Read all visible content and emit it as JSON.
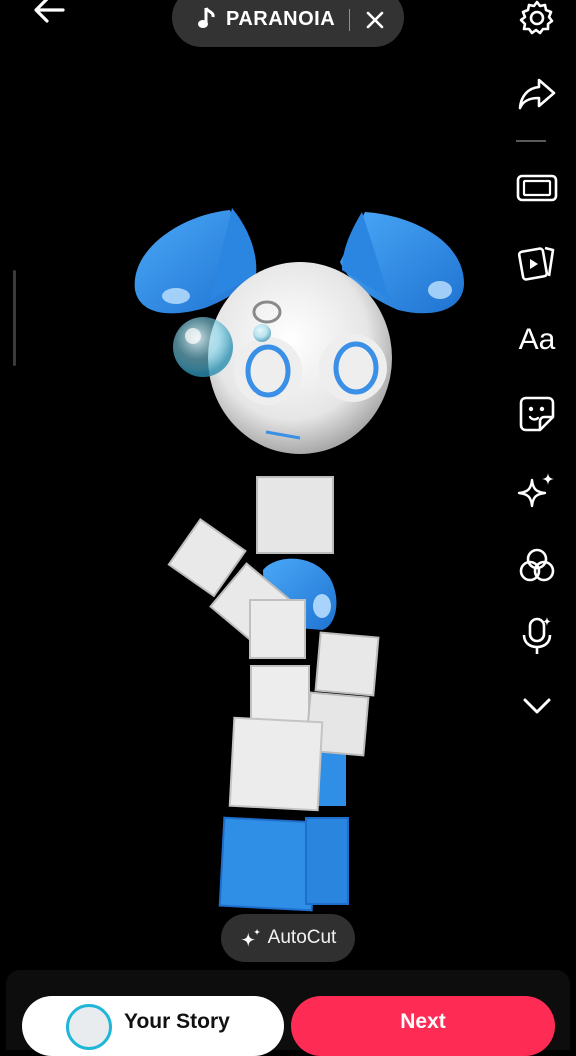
{
  "header": {
    "sound_title": "PARANOIA",
    "back_icon": "arrow-left-icon",
    "close_icon": "close-icon"
  },
  "right_rail": [
    {
      "name": "settings",
      "icon": "gear-icon"
    },
    {
      "name": "share",
      "icon": "share-arrow-icon"
    },
    {
      "name": "aspect-ratio",
      "icon": "aspect-ratio-icon"
    },
    {
      "name": "templates",
      "icon": "video-cards-icon"
    },
    {
      "name": "text",
      "icon": "text-icon",
      "label": "Aa"
    },
    {
      "name": "stickers",
      "icon": "sticker-icon"
    },
    {
      "name": "effects",
      "icon": "sparkle-icon"
    },
    {
      "name": "filters",
      "icon": "filter-circles-icon"
    },
    {
      "name": "voice",
      "icon": "mic-sparkle-icon"
    },
    {
      "name": "more",
      "icon": "chevron-down-icon"
    }
  ],
  "autocut": {
    "label": "AutoCut",
    "icon": "sparkle-icon"
  },
  "footer": {
    "story_label": "Your Story",
    "next_label": "Next"
  },
  "colors": {
    "next": "#fe2c55",
    "character_blue": "#2f8fe6",
    "background": "#000000"
  }
}
